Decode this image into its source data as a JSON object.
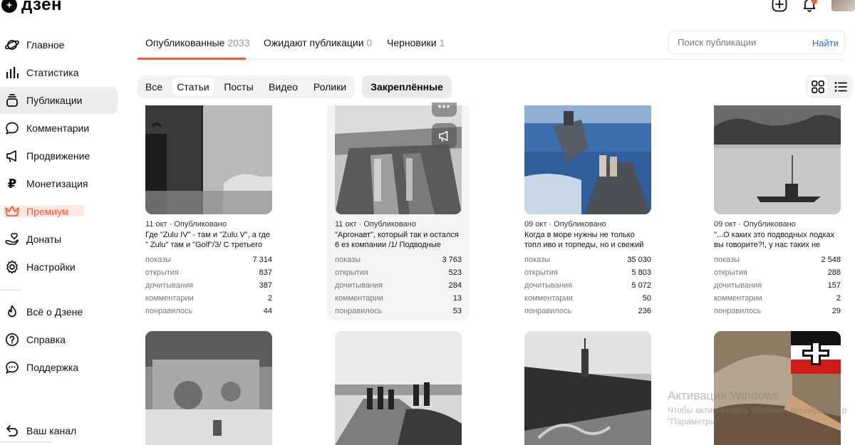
{
  "brand": {
    "name": "дзен"
  },
  "sidebar": {
    "items": [
      {
        "label": "Главное",
        "icon": "planet-icon"
      },
      {
        "label": "Статистика",
        "icon": "bar-chart-icon"
      },
      {
        "label": "Публикации",
        "icon": "stack-icon",
        "active": true
      },
      {
        "label": "Комментарии",
        "icon": "comment-icon"
      },
      {
        "label": "Продвижение",
        "icon": "megaphone-icon"
      },
      {
        "label": "Монетизация",
        "icon": "ruble-icon"
      },
      {
        "label": "Премиум",
        "icon": "crown-icon"
      },
      {
        "label": "Донаты",
        "icon": "donate-icon"
      },
      {
        "label": "Настройки",
        "icon": "gear-icon"
      }
    ],
    "secondary": [
      {
        "label": "Всё о Дзене",
        "icon": "flame-icon"
      },
      {
        "label": "Справка",
        "icon": "help-icon"
      },
      {
        "label": "Поддержка",
        "icon": "support-icon"
      }
    ],
    "channel": {
      "label": "Ваш канал",
      "icon": "back-arrow-icon"
    }
  },
  "tabs": [
    {
      "label": "Опубликованные",
      "count": "2033",
      "active": true
    },
    {
      "label": "Ожидают публикации",
      "count": "0"
    },
    {
      "label": "Черновики",
      "count": "1"
    }
  ],
  "search": {
    "placeholder": "Поиск публикации",
    "button": "Найти"
  },
  "filters": {
    "chips": [
      "Все",
      "Статьи",
      "Посты",
      "Видео",
      "Ролики"
    ],
    "selected": "Статьи",
    "pinned": "Закреплённые"
  },
  "stat_labels": [
    "показы",
    "открытия",
    "дочитывания",
    "комментарии",
    "понравилось"
  ],
  "cards": [
    {
      "date": "11 окт",
      "status": "Опубликовано",
      "title": "Где \"Zulu IV\" - там и \"Zulu V\", а где \" Zulu\" там и \"Golf\"/3/ С третьего ра...",
      "stats": [
        "7 314",
        "837",
        "387",
        "2",
        "44"
      ]
    },
    {
      "date": "11 окт",
      "status": "Опубликовано",
      "title": "\"Аргонавт\", который так и остался 6 ез компании /1/ Подводные крей...",
      "stats": [
        "3 763",
        "523",
        "284",
        "13",
        "53"
      ]
    },
    {
      "date": "09 окт",
      "status": "Опубликовано",
      "title": "Когда в море нужны не только топл иво и торпеды, но и свежий хлеб...",
      "stats": [
        "35 030",
        "5 803",
        "5 072",
        "50",
        "236"
      ]
    },
    {
      "date": "09 окт",
      "status": "Опубликовано",
      "title": "\"...О каких это подводных лодках вы говорите?!, у нас таких не имеется...",
      "stats": [
        "2 548",
        "288",
        "157",
        "2",
        "29"
      ]
    }
  ],
  "watermark": {
    "line1": "Активация Windows",
    "line2": "Чтобы активировать Windows, перейдите в р",
    "line3": "\"Параметры\"."
  }
}
